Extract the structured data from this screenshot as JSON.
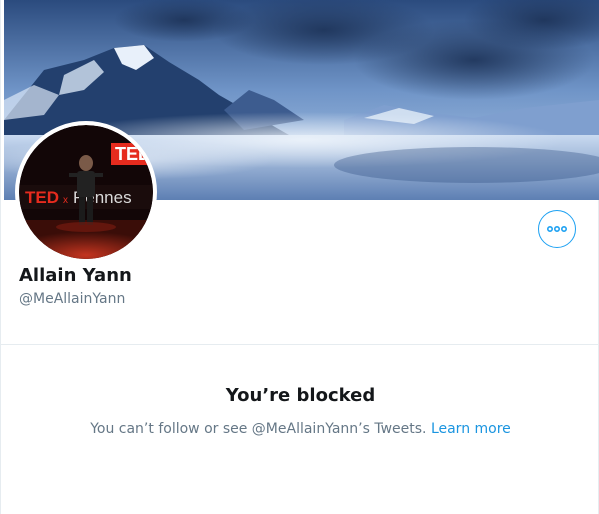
{
  "profile": {
    "display_name": "Allain Yann",
    "handle": "@MeAllainYann",
    "banner_image": "snowy-mountain-lake-banner",
    "avatar_image": "speaker-on-tedx-stage",
    "avatar_sign_text": "TEDxRennes"
  },
  "actions": {
    "more_icon": "more-horizontal-icon"
  },
  "blocked": {
    "title": "You’re blocked",
    "message": "You can’t follow or see @MeAllainYann’s Tweets.",
    "link_label": "Learn more"
  },
  "colors": {
    "accent": "#1da1f2",
    "link": "#1b95e0",
    "text_primary": "#14171a",
    "text_secondary": "#657786",
    "border": "#e6ecf0"
  }
}
